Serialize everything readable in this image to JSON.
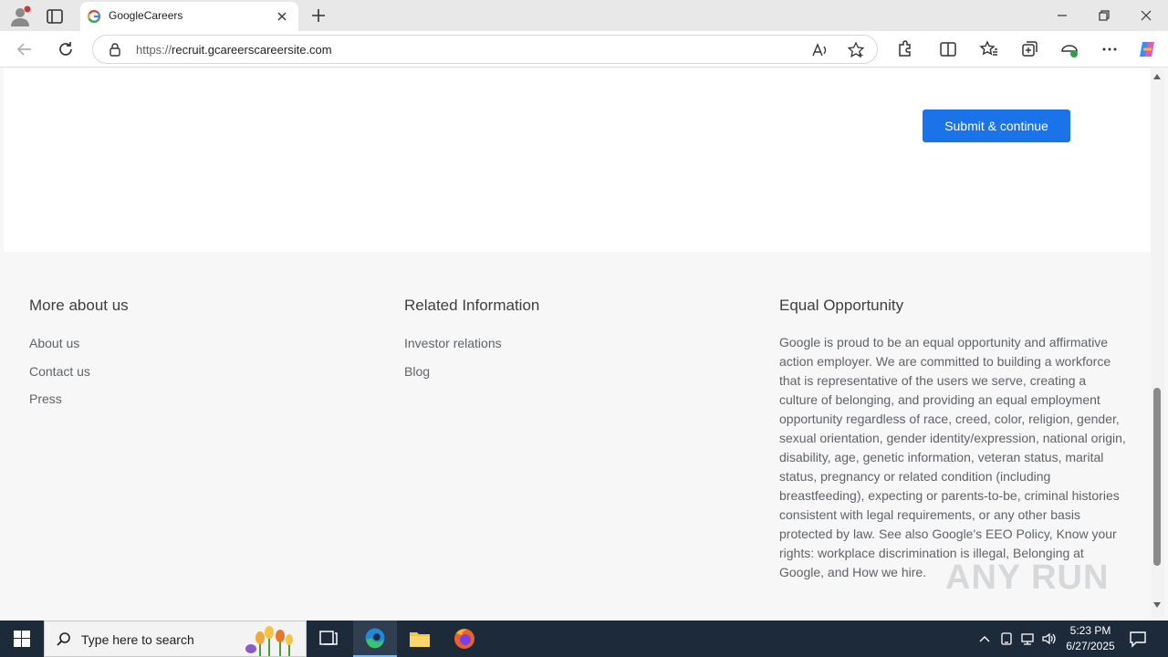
{
  "browser": {
    "tab_title": "GoogleCareers",
    "url_prefix": "https://",
    "url_host": "recruit.gcareerscareersite.com"
  },
  "page": {
    "submit_label": "Submit & continue",
    "footer": {
      "more_about_us": {
        "heading": "More about us",
        "links": [
          "About us",
          "Contact us",
          "Press"
        ]
      },
      "related_information": {
        "heading": "Related Information",
        "links": [
          "Investor relations",
          "Blog"
        ]
      },
      "equal_opportunity": {
        "heading": "Equal Opportunity",
        "text": "Google is proud to be an equal opportunity and affirmative action employer. We are committed to building a workforce that is representative of the users we serve, creating a culture of belonging, and providing an equal employment opportunity regardless of race, creed, color, religion, gender, sexual orientation, gender identity/expression, national origin, disability, age, genetic information, veteran status, marital status, pregnancy or related condition (including breastfeeding), expecting or parents-to-be, criminal histories consistent with legal requirements, or any other basis protected by law. See also Google's EEO Policy, Know your rights: workplace discrimination is illegal, Belonging at Google, and How we hire."
      }
    },
    "watermark": "ANY RUN"
  },
  "taskbar": {
    "search_placeholder": "Type here to search",
    "time": "5:23 PM",
    "date": "6/27/2025"
  },
  "colors": {
    "accent": "#1a73e8",
    "taskbar": "#1c2a3a"
  }
}
